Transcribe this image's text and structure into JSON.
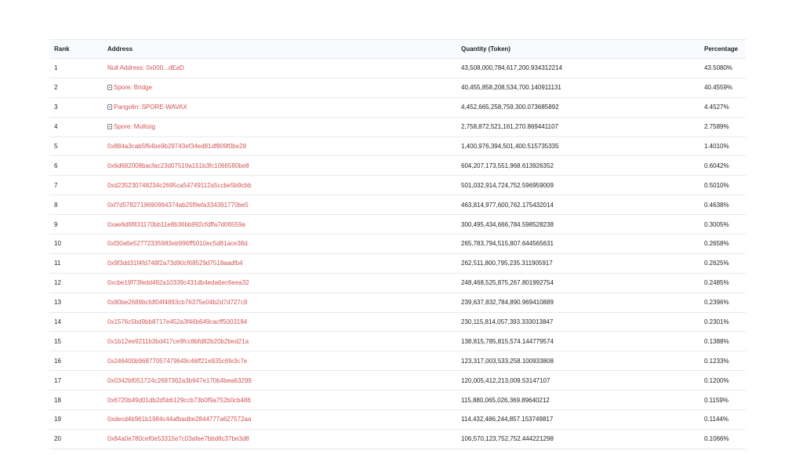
{
  "headers": {
    "rank": "Rank",
    "address": "Address",
    "quantity": "Quantity (Token)",
    "percentage": "Percentage"
  },
  "rows": [
    {
      "rank": "1",
      "address": "Null Address: 0x000...dEaD",
      "contract": false,
      "quantity": "43,508,000,784,617,200.934312214",
      "percentage": "43.5080%"
    },
    {
      "rank": "2",
      "address": "Spore: Bridge",
      "contract": true,
      "quantity": "40,455,858,208,534,700.140911131",
      "percentage": "40.4559%"
    },
    {
      "rank": "3",
      "address": "Pangolin: SPORE-WAVAX",
      "contract": true,
      "quantity": "4,452,665,258,759,300.073685892",
      "percentage": "4.4527%"
    },
    {
      "rank": "4",
      "address": "Spore: Multisig",
      "contract": true,
      "quantity": "2,758,872,521,161,270.869441107",
      "percentage": "2.7589%"
    },
    {
      "rank": "5",
      "address": "0x884a3cab5f64be9b29743ef34ed81df809f0be28",
      "contract": false,
      "quantity": "1,400,976,394,501,400.515735335",
      "percentage": "1.4010%"
    },
    {
      "rank": "6",
      "address": "0x6d682008bacfac23d07519a151b3fc1066580be8",
      "contract": false,
      "quantity": "604,207,173,551,968.613926352",
      "percentage": "0.6042%"
    },
    {
      "rank": "7",
      "address": "0xd23523074823 4c2695ca54749112a5ccbe5b9cbb",
      "contract": false,
      "quantity": "501,032,914,724,752.596959009",
      "percentage": "0.5010%"
    },
    {
      "rank": "8",
      "address": "0xf7d578271969099 4374ab25f9efa334391770be5",
      "contract": false,
      "quantity": "463,814,977,600,762.175432014",
      "percentage": "0.4638%"
    },
    {
      "rank": "9",
      "address": "0xae6d6f831170bb11e8b36bb992cfdffa7d06559a",
      "contract": false,
      "quantity": "300,495,434,666,784.598528238",
      "percentage": "0.3005%"
    },
    {
      "rank": "10",
      "address": "0xf30a6e52772335983eb996ff5010ec5d81ace38d",
      "contract": false,
      "quantity": "265,783,794,515,807.644565631",
      "percentage": "0.2658%"
    },
    {
      "rank": "11",
      "address": "0x9f3dd31f4fd748f2a73d90cf68529d7518aadfb4",
      "contract": false,
      "quantity": "262,511,800,795,235.311905917",
      "percentage": "0.2625%"
    },
    {
      "rank": "12",
      "address": "0xcbe19f73fedd492a10339c431db4eda6ec6eea32",
      "contract": false,
      "quantity": "248,468,525,875,267.801992754",
      "percentage": "0.2485%"
    },
    {
      "rank": "13",
      "address": "0x80be2689bcfdf04f4893cb76375e04b2d7d727c9",
      "contract": false,
      "quantity": "239,637,832,784,890.969410889",
      "percentage": "0.2396%"
    },
    {
      "rank": "14",
      "address": "0x1576c5bd9bb8717e452a3f46b649cacff5003184",
      "contract": false,
      "quantity": "230,115,814,057,393.333013847",
      "percentage": "0.2301%"
    },
    {
      "rank": "15",
      "address": "0x1b12ee9211b3bd417ce9fcc8bfd82b20b2bed21a",
      "contract": false,
      "quantity": "138,815,785,815,574.144779574",
      "percentage": "0.1388%"
    },
    {
      "rank": "16",
      "address": "0x246400b96877057479649c46ff21e935c6fe3c7e",
      "contract": false,
      "quantity": "123,317,003,533,258.100933808",
      "percentage": "0.1233%"
    },
    {
      "rank": "17",
      "address": "0x0342bf051724c2697362a3b947e170b4bea63299",
      "contract": false,
      "quantity": "120,005,412,213,009.53147107",
      "percentage": "0.1200%"
    },
    {
      "rank": "18",
      "address": "0x6720b49d01db2d5b6129ccb73b0f9a752b0cb486",
      "contract": false,
      "quantity": "115,880,065,026,369.89640212",
      "percentage": "0.1159%"
    },
    {
      "rank": "19",
      "address": "0xdecd4b961b1984c44afbadbe2844777a627572aa",
      "contract": false,
      "quantity": "114,432,486,244,857.153749817",
      "percentage": "0.1144%"
    },
    {
      "rank": "20",
      "address": "0x84a0e780cef0e53315e7c03afee7bbd8c37be3d8",
      "contract": false,
      "quantity": "106,570,123,752,752.444221298",
      "percentage": "0.1066%"
    }
  ],
  "colors": {
    "link": "#d35454",
    "header_bg": "#f8fafd",
    "border": "#e7eaf3"
  }
}
